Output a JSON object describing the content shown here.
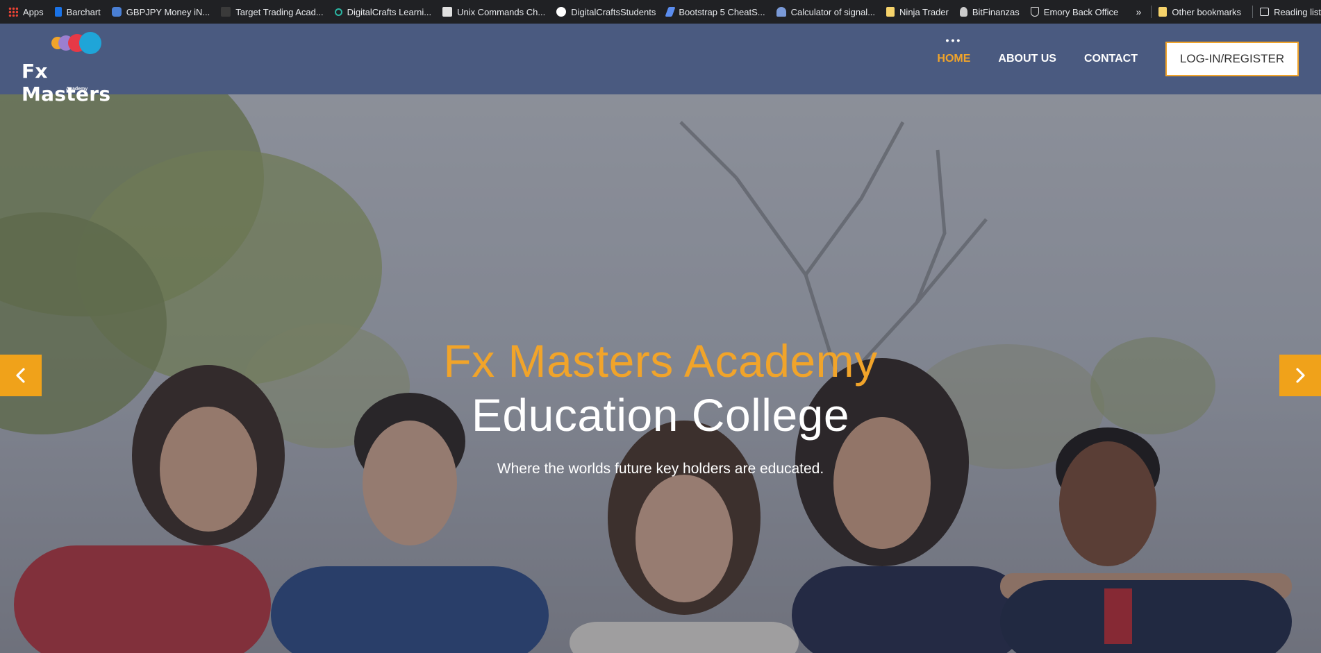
{
  "bookmarks": {
    "items": [
      {
        "label": "Apps",
        "icon": "apps-grid-icon",
        "color": "#e8453c"
      },
      {
        "label": "Barchart",
        "icon": "barchart-icon",
        "color": "#1a73e8"
      },
      {
        "label": "GBPJPY Money iN...",
        "icon": "money-icon",
        "color": "#4a7fd4"
      },
      {
        "label": "Target Trading Acad...",
        "icon": "target-icon",
        "color": "#333333"
      },
      {
        "label": "DigitalCrafts Learni...",
        "icon": "link-icon",
        "color": "#2bb6a3"
      },
      {
        "label": "Unix Commands Ch...",
        "icon": "document-icon",
        "color": "#e0e0e0"
      },
      {
        "label": "DigitalCraftsStudents",
        "icon": "github-icon",
        "color": "#ffffff"
      },
      {
        "label": "Bootstrap 5 CheatS...",
        "icon": "bootstrap-icon",
        "color": "#5b8def"
      },
      {
        "label": "Calculator of signal...",
        "icon": "graduation-cap-icon",
        "color": "#7a9ad8"
      },
      {
        "label": "Ninja Trader",
        "icon": "folder-icon",
        "color": "#f6d36b"
      },
      {
        "label": "BitFinanzas",
        "icon": "person-icon",
        "color": "#cccccc"
      },
      {
        "label": "Emory Back Office",
        "icon": "shield-icon",
        "color": "#dddddd"
      }
    ],
    "overflow_icon": "»",
    "other_bookmarks": "Other bookmarks",
    "reading_list": "Reading list"
  },
  "nav": {
    "logo_title": "Fx Masters",
    "logo_sub": "Academy",
    "links": [
      "HOME",
      "ABOUT US",
      "CONTACT"
    ],
    "active": "HOME",
    "login_label": "LOG-IN/REGISTER"
  },
  "hero": {
    "title": "Fx Masters Academy",
    "subtitle": "Education College",
    "tagline": "Where the worlds future key holders are educated.",
    "prev_icon": "chevron-left-icon",
    "next_icon": "chevron-right-icon"
  },
  "colors": {
    "accent": "#f1a42a",
    "navbar": "#4a5a80",
    "arrow_bg": "#f0a21a",
    "bookmarks_bg": "#202124"
  }
}
